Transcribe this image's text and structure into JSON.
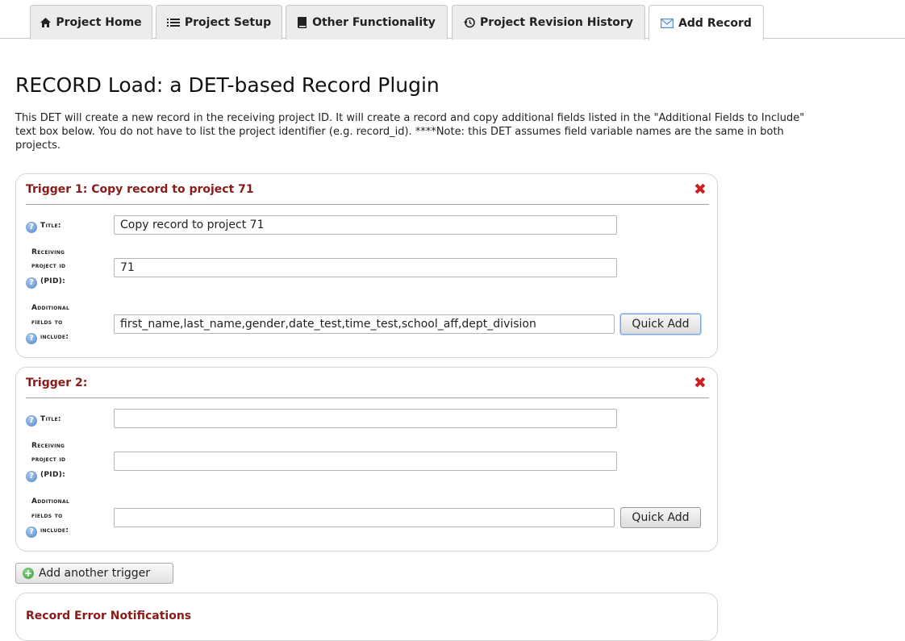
{
  "tabs": [
    {
      "label": "Project Home",
      "icon": "home-icon"
    },
    {
      "label": "Project Setup",
      "icon": "list-icon"
    },
    {
      "label": "Other Functionality",
      "icon": "book-icon"
    },
    {
      "label": "Project Revision History",
      "icon": "history-icon"
    },
    {
      "label": "Add Record",
      "icon": "envelope-icon",
      "active": true
    }
  ],
  "page": {
    "title": "RECORD Load: a DET-based Record Plugin",
    "description": "This DET will create a new record in the receiving project ID. It will create a record and copy additional fields listed in the \"Additional Fields to Include\" text box below. You do not have to list the project identifier (e.g. record_id). ****Note: this DET assumes field variable names are the same in both projects."
  },
  "labels": {
    "title": "Title:",
    "receiving_line1": "Receiving",
    "receiving_line2": "project id",
    "receiving_line3": "(PID):",
    "additional_line1": "Additional",
    "additional_line2": "fields to",
    "additional_line3": "include:",
    "quick_add": "Quick Add",
    "add_trigger": "Add another trigger"
  },
  "triggers": [
    {
      "header": "Trigger 1: Copy record to project 71",
      "title_value": "Copy record to project 71",
      "pid_value": "71",
      "fields_value": "first_name,last_name,gender,date_test,time_test,school_aff,dept_division"
    },
    {
      "header": "Trigger 2:",
      "title_value": "",
      "pid_value": "",
      "fields_value": ""
    }
  ],
  "panel3": {
    "header": "Record Error Notifications"
  },
  "colors": {
    "accent_red": "#8b1a1a",
    "close_red": "#cc1f1f",
    "help_blue": "#4f87c7"
  }
}
